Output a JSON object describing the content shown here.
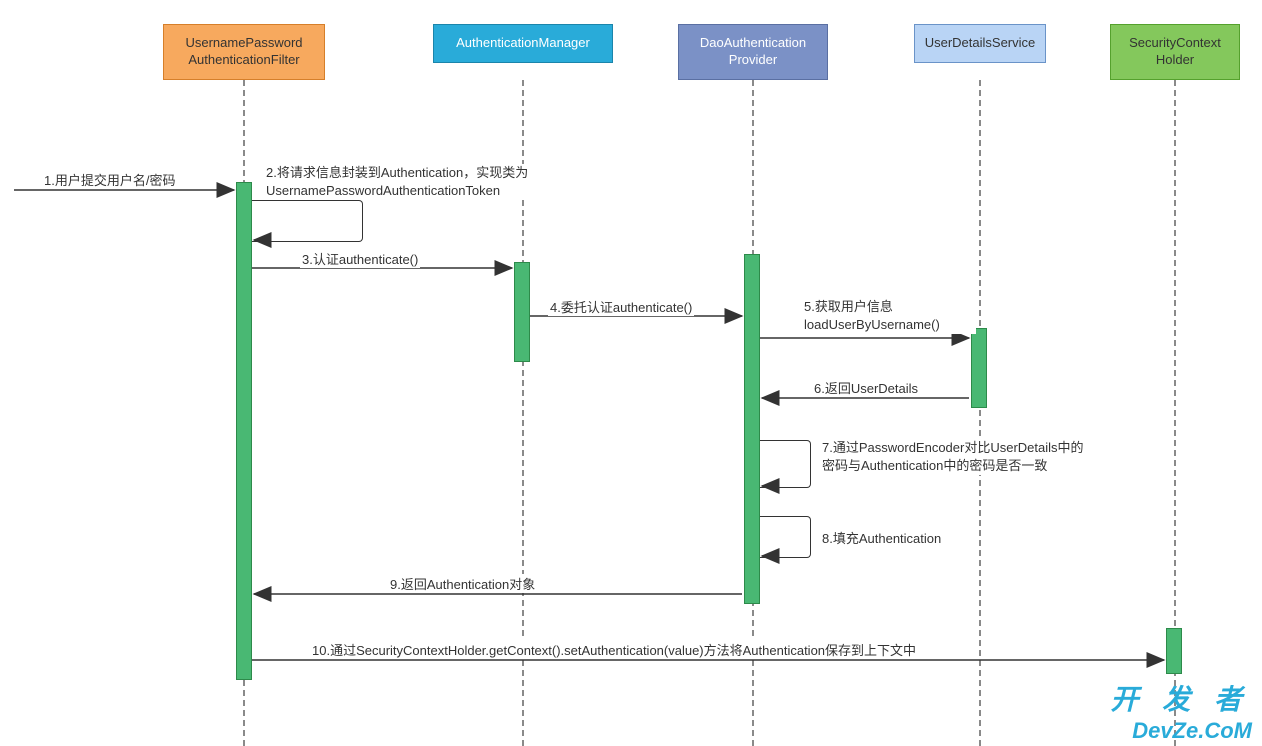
{
  "participants": {
    "filter": "UsernamePassword\nAuthenticationFilter",
    "manager": "AuthenticationManager",
    "provider": "DaoAuthentication\nProvider",
    "uds": "UserDetailsService",
    "holder": "SecurityContext\nHolder"
  },
  "messages": {
    "m1": "1.用户提交用户名/密码",
    "m2a": "2.将请求信息封装到Authentication，实现类为",
    "m2b": "UsernamePasswordAuthenticationToken",
    "m3": "3.认证authenticate()",
    "m4": "4.委托认证authenticate()",
    "m5a": "5.获取用户信息",
    "m5b": "loadUserByUsername()",
    "m6": "6.返回UserDetails",
    "m7a": "7.通过PasswordEncoder对比UserDetails中的",
    "m7b": "密码与Authentication中的密码是否一致",
    "m8": "8.填充Authentication",
    "m9": "9.返回Authentication对象",
    "m10": "10.通过SecurityContextHolder.getContext().setAuthentication(value)方法将Authentication保存到上下文中"
  },
  "watermark": {
    "l1": "开 发 者",
    "l2": "DevZe.CoM"
  }
}
